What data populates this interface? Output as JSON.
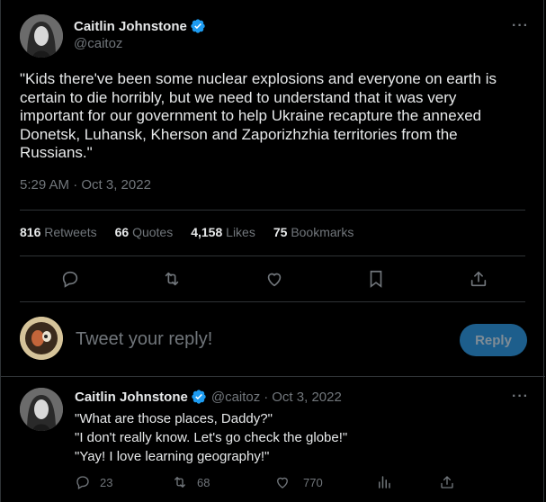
{
  "main_tweet": {
    "author_name": "Caitlin Johnstone",
    "author_handle": "@caitoz",
    "text": "\"Kids there've been some nuclear explosions and everyone on earth is certain to die horribly, but we need to understand that it was very important for our government to help Ukraine recapture the annexed Donetsk, Luhansk, Kherson and Zaporizhzhia territories from the Russians.\"",
    "timestamp": "5:29 AM · Oct 3, 2022",
    "stats": {
      "retweets_count": "816",
      "retweets_label": "Retweets",
      "quotes_count": "66",
      "quotes_label": "Quotes",
      "likes_count": "4,158",
      "likes_label": "Likes",
      "bookmarks_count": "75",
      "bookmarks_label": "Bookmarks"
    },
    "more_label": "···"
  },
  "composer": {
    "placeholder": "Tweet your reply!",
    "reply_button": "Reply"
  },
  "reply_tweet": {
    "author_name": "Caitlin Johnstone",
    "author_handle": "@caitoz",
    "date": "Oct 3, 2022",
    "separator": "·",
    "more_label": "···",
    "lines": [
      "\"What are those places, Daddy?\"",
      "\"I don't really know. Let's go check the globe!\"",
      "\"Yay! I love learning geography!\""
    ],
    "replies": "23",
    "retweets": "68",
    "likes": "770"
  },
  "colors": {
    "background": "#000000",
    "text": "#e7e9ea",
    "muted": "#71767b",
    "verified": "#1d9bf0",
    "reply_button_bg": "#1d5e8c"
  }
}
